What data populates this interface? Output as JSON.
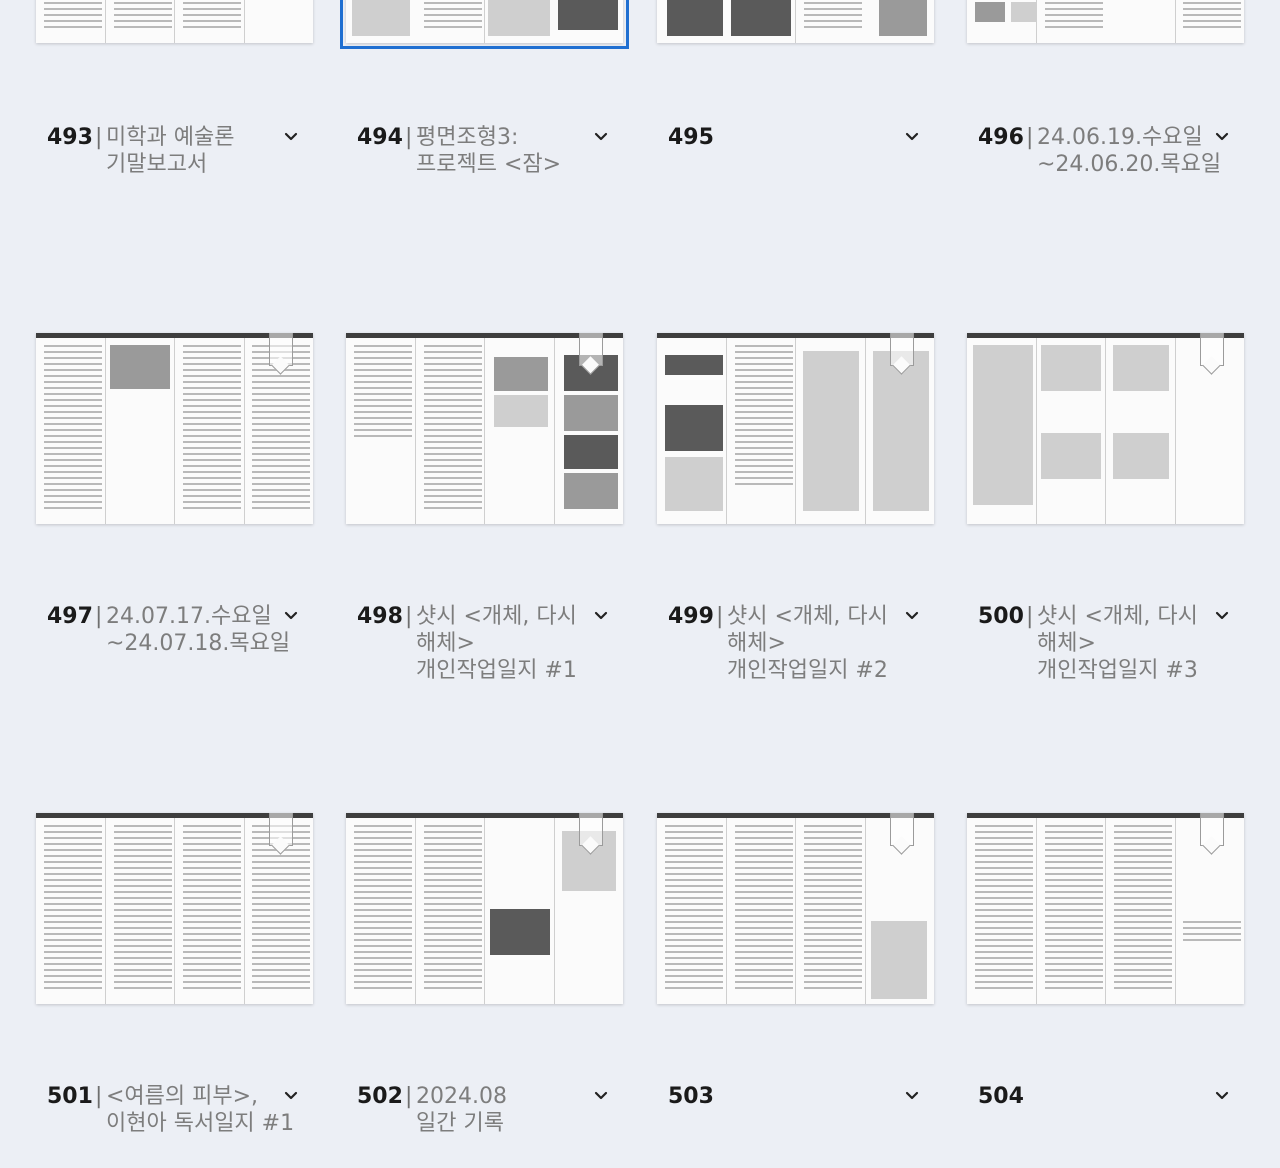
{
  "items": [
    {
      "number": "493",
      "title": "미학과 예술론\n기말보고서"
    },
    {
      "number": "494",
      "title": "평면조형3:\n프로젝트 <잠>"
    },
    {
      "number": "495",
      "title": ""
    },
    {
      "number": "496",
      "title": "24.06.19.수요일\n~24.06.20.목요일"
    },
    {
      "number": "497",
      "title": "24.07.17.수요일\n~24.07.18.목요일"
    },
    {
      "number": "498",
      "title": "샷시 <개체, 다시\n해체>\n개인작업일지 #1"
    },
    {
      "number": "499",
      "title": "샷시 <개체, 다시\n해체>\n개인작업일지 #2"
    },
    {
      "number": "500",
      "title": "샷시 <개체, 다시\n해체>\n개인작업일지 #3"
    },
    {
      "number": "501",
      "title": "<여름의 피부>,\n이현아 독서일지 #1"
    },
    {
      "number": "502",
      "title": "2024.08\n일간 기록"
    },
    {
      "number": "503",
      "title": ""
    },
    {
      "number": "504",
      "title": ""
    }
  ],
  "separator": "|",
  "icons": {
    "menu": "chevron-down-icon",
    "bookmark": "bookmark-icon"
  },
  "colors": {
    "selected_outline": "#1f6fd1",
    "background": "#eceff5"
  }
}
